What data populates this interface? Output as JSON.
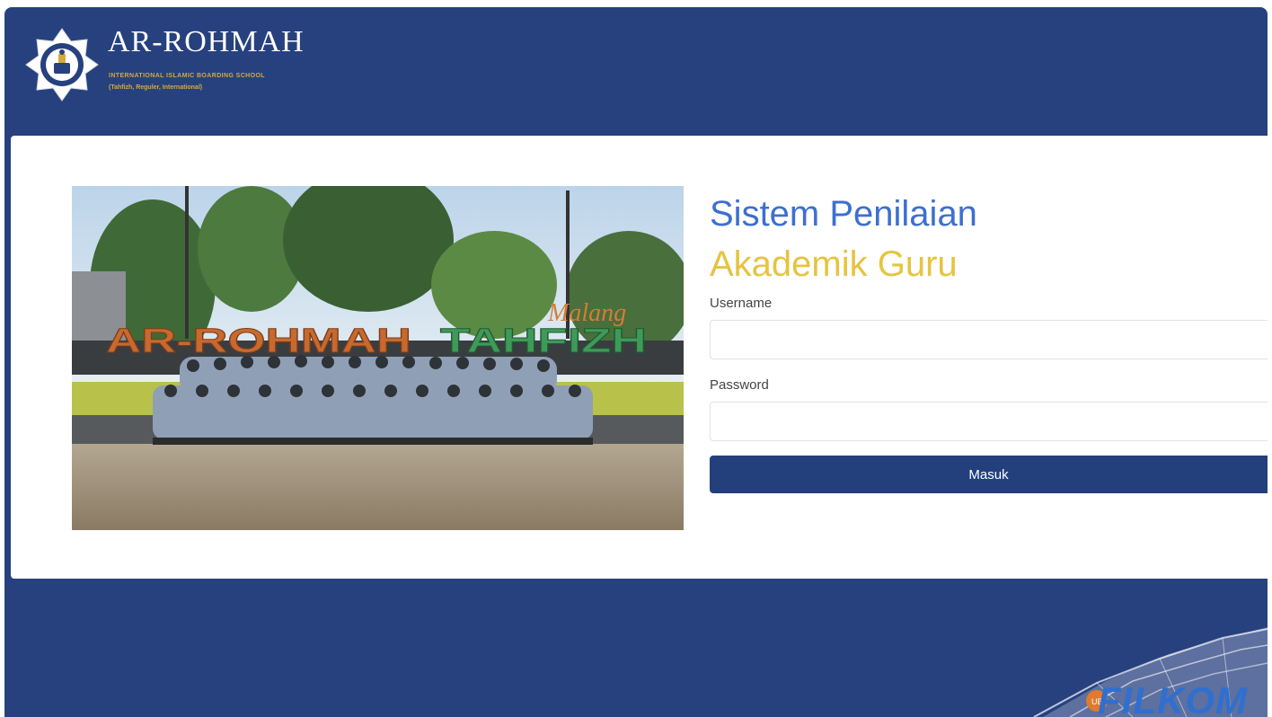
{
  "brand": {
    "name": "AR-ROHMAH",
    "tagline": "INTERNATIONAL ISLAMIC BOARDING SCHOOL",
    "programs": "(Tahfizh, Reguler, International)"
  },
  "hero": {
    "sign_main": "AR-ROHMAH",
    "sign_sub": "TAHFIZH",
    "sign_script": "Malang"
  },
  "login": {
    "title_line1": "Sistem Penilaian",
    "title_line2": "Akademik Guru",
    "username_label": "Username",
    "username_value": "",
    "password_label": "Password",
    "password_value": "",
    "submit_label": "Masuk"
  },
  "watermark": {
    "text": "FILKOM",
    "badge": "UB"
  },
  "colors": {
    "primary": "#27417f",
    "title_blue": "#3d6fd1",
    "title_gold": "#e5c440",
    "brand_gold": "#d6a93a",
    "button": "#23407d"
  },
  "icons": {
    "logo": "school-emblem-icon",
    "watermark": "filkom-logo-icon"
  }
}
